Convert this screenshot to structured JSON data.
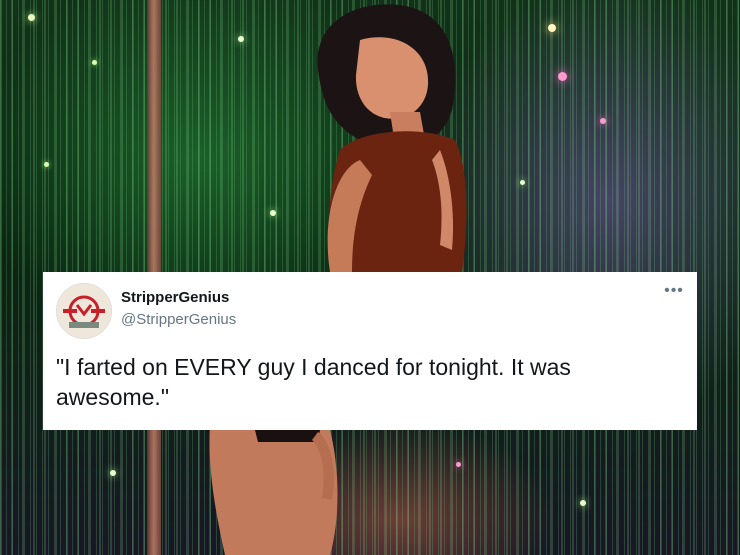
{
  "tweet": {
    "display_name": "StripperGenius",
    "handle": "@StripperGenius",
    "text": "\"I farted on EVERY guy I danced for tonight. It was awesome.\"",
    "more_icon": "more-horizontal-icon"
  },
  "colors": {
    "card_bg": "#ffffff",
    "name_color": "#14171a",
    "handle_color": "#657786"
  }
}
